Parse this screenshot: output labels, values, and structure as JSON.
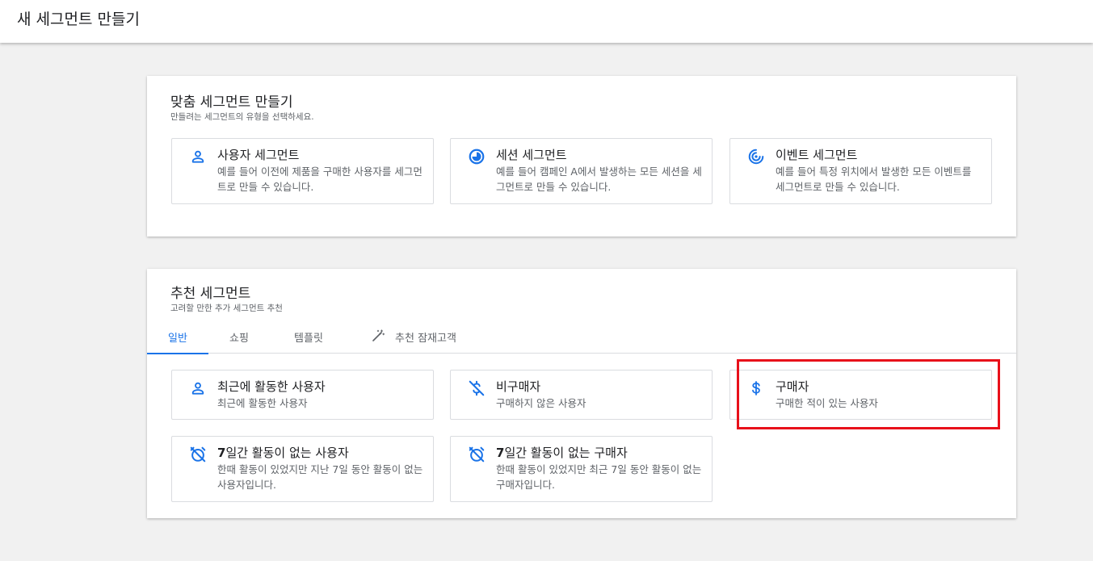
{
  "header": {
    "title": "새 세그먼트 만들기"
  },
  "custom": {
    "title": "맞춤 세그먼트 만들기",
    "subtitle": "만들려는 세그먼트의 유형을 선택하세요.",
    "tiles": [
      {
        "icon": "person-icon",
        "title": "사용자 세그먼트",
        "desc": "예를 들어 이전에 제품을 구매한 사용자를 세그먼트로 만들 수 있습니다."
      },
      {
        "icon": "session-icon",
        "title": "세션 세그먼트",
        "desc": "예를 들어 캠페인 A에서 발생하는 모든 세션을 세그먼트로 만들 수 있습니다."
      },
      {
        "icon": "event-icon",
        "title": "이벤트 세그먼트",
        "desc": "예를 들어 특정 위치에서 발생한 모든 이벤트를 세그먼트로 만들 수 있습니다."
      }
    ]
  },
  "suggested": {
    "title": "추천 세그먼트",
    "subtitle": "고려할 만한 추가 세그먼트 추천",
    "tabs": [
      "일반",
      "쇼핑",
      "템플릿",
      "추천 잠재고객"
    ],
    "active_tab": "일반",
    "tiles": [
      {
        "icon": "person-icon",
        "title": "최근에 활동한 사용자",
        "desc": "최근에 활동한 사용자"
      },
      {
        "icon": "no-money-icon",
        "title": "비구매자",
        "desc": "구매하지 않은 사용자"
      },
      {
        "icon": "dollar-icon",
        "title": "구매자",
        "desc": "구매한 적이 있는 사용자"
      },
      {
        "icon": "alarm-off-icon",
        "title_num": "7",
        "title": "일간 활동이 없는 사용자",
        "desc": "한때 활동이 있었지만 지난 7일 동안 활동이 없는 사용자입니다."
      },
      {
        "icon": "alarm-off-icon",
        "title_num": "7",
        "title": "일간 활동이 없는 구매자",
        "desc": "한때 활동이 있었지만 최근 7일 동안 활동이 없는 구매자입니다."
      }
    ]
  },
  "colors": {
    "accent": "#1a73e8",
    "highlight": "#e8101a"
  }
}
